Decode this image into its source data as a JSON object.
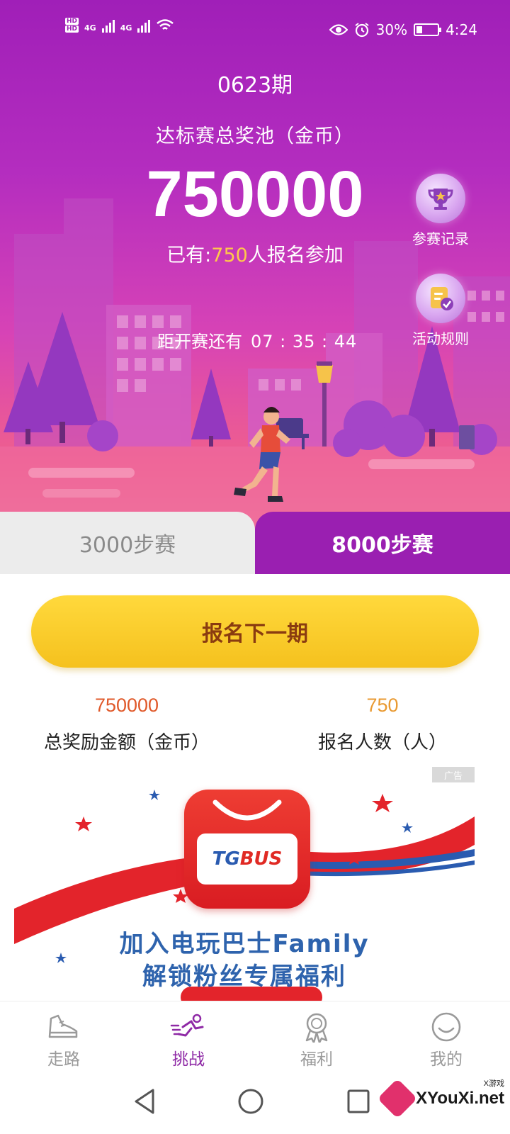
{
  "status_bar": {
    "hd1": "HD",
    "hd2": "HD",
    "net1": "4G",
    "net2": "4G",
    "battery_pct": "30%",
    "battery_level": 0.3,
    "time": "4:24"
  },
  "hero": {
    "issue": "0623期",
    "pool_label": "达标赛总奖池（金币）",
    "pool_amount": "750000",
    "signup_prefix": "已有:",
    "signup_count": "750",
    "signup_suffix": "人报名参加",
    "countdown_label": "距开赛还有",
    "countdown_time": "07 : 35 : 44"
  },
  "side_buttons": {
    "record_label": "参赛记录",
    "rules_label": "活动规则",
    "record_icon": "trophy-icon",
    "rules_icon": "checklist-icon"
  },
  "tabs": {
    "tab1": "3000步赛",
    "tab2": "8000步赛",
    "active": "tab2"
  },
  "cta_label": "报名下一期",
  "stats": {
    "reward_value": "750000",
    "reward_label": "总奖励金额（金币）",
    "people_value": "750",
    "people_label": "报名人数（人）"
  },
  "ad": {
    "tag": "广告",
    "logo_tg": "TG",
    "logo_bus": "BUS",
    "line1": "加入电玩巴士Family",
    "line2": "解锁粉丝专属福利"
  },
  "bottom_nav": {
    "walk": "走路",
    "challenge": "挑战",
    "welfare": "福利",
    "mine": "我的",
    "active": "challenge"
  },
  "watermark": {
    "text": "XYouXi.net",
    "small": "X游戏"
  },
  "colors": {
    "primary_purple": "#9a1fb1",
    "cta_yellow": "#ffd93c",
    "reward_orange": "#e0592a",
    "people_orange": "#e99a32",
    "highlight_yellow": "#ffc94a"
  }
}
